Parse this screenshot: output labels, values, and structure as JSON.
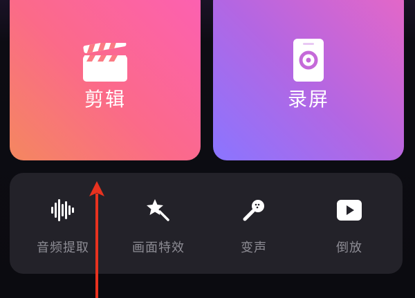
{
  "tiles": {
    "edit": {
      "label": "剪辑",
      "icon": "clapperboard-icon"
    },
    "record": {
      "label": "录屏",
      "icon": "screen-record-icon"
    }
  },
  "tools": [
    {
      "label": "音频提取",
      "icon": "audio-waveform-icon"
    },
    {
      "label": "画面特效",
      "icon": "magic-wand-icon"
    },
    {
      "label": "变声",
      "icon": "microphone-icon"
    },
    {
      "label": "倒放",
      "icon": "play-reverse-icon"
    }
  ],
  "colors": {
    "background": "#0b0b10",
    "tool_panel": "#232229",
    "tool_label": "#8e8d95",
    "annotation_arrow": "#e8321f"
  }
}
